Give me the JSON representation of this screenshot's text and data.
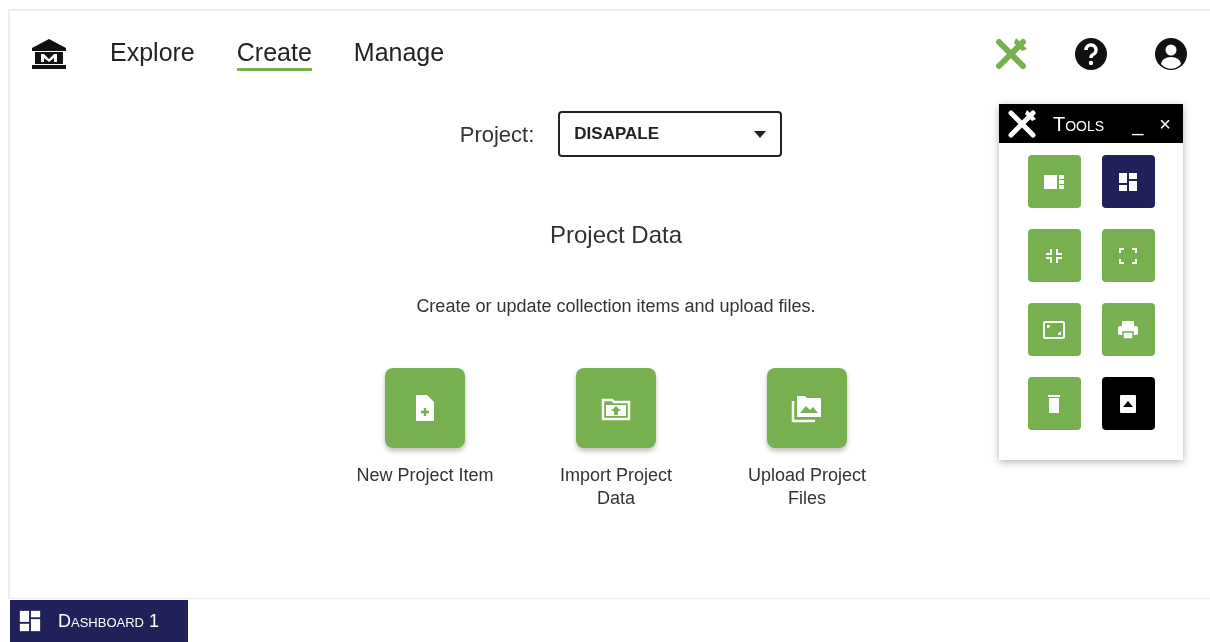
{
  "nav": [
    {
      "label": "Explore",
      "selected": false
    },
    {
      "label": "Create",
      "selected": true
    },
    {
      "label": "Manage",
      "selected": false
    }
  ],
  "header_icons": [
    {
      "kind": "tools",
      "on": true
    },
    {
      "kind": "help",
      "on": false
    },
    {
      "kind": "user",
      "on": false
    }
  ],
  "project": {
    "label": "Project:",
    "value": "DISAPALE"
  },
  "section": {
    "title": "Project Data",
    "description": "Create or update collection items and upload files."
  },
  "actions": [
    {
      "kind": "new-file",
      "label": "New Project Item"
    },
    {
      "kind": "import-folder",
      "label": "Import Project Data"
    },
    {
      "kind": "images",
      "label": "Upload Project Files"
    }
  ],
  "tools_panel": {
    "title": "Tools",
    "minimize": "_",
    "close": "×",
    "tools": [
      {
        "kind": "sidebar",
        "color": "#76b04f"
      },
      {
        "kind": "dashboard",
        "color": "#1f2158"
      },
      {
        "kind": "collapse",
        "color": "#76b04f"
      },
      {
        "kind": "expand",
        "color": "#76b04f"
      },
      {
        "kind": "frame",
        "color": "#76b04f"
      },
      {
        "kind": "print",
        "color": "#76b04f"
      },
      {
        "kind": "trash",
        "color": "#76b04f"
      },
      {
        "kind": "archive",
        "color": "#000000"
      }
    ]
  },
  "dashboard_tabs": [
    {
      "label": "Dashboard 1",
      "selected": true
    }
  ]
}
